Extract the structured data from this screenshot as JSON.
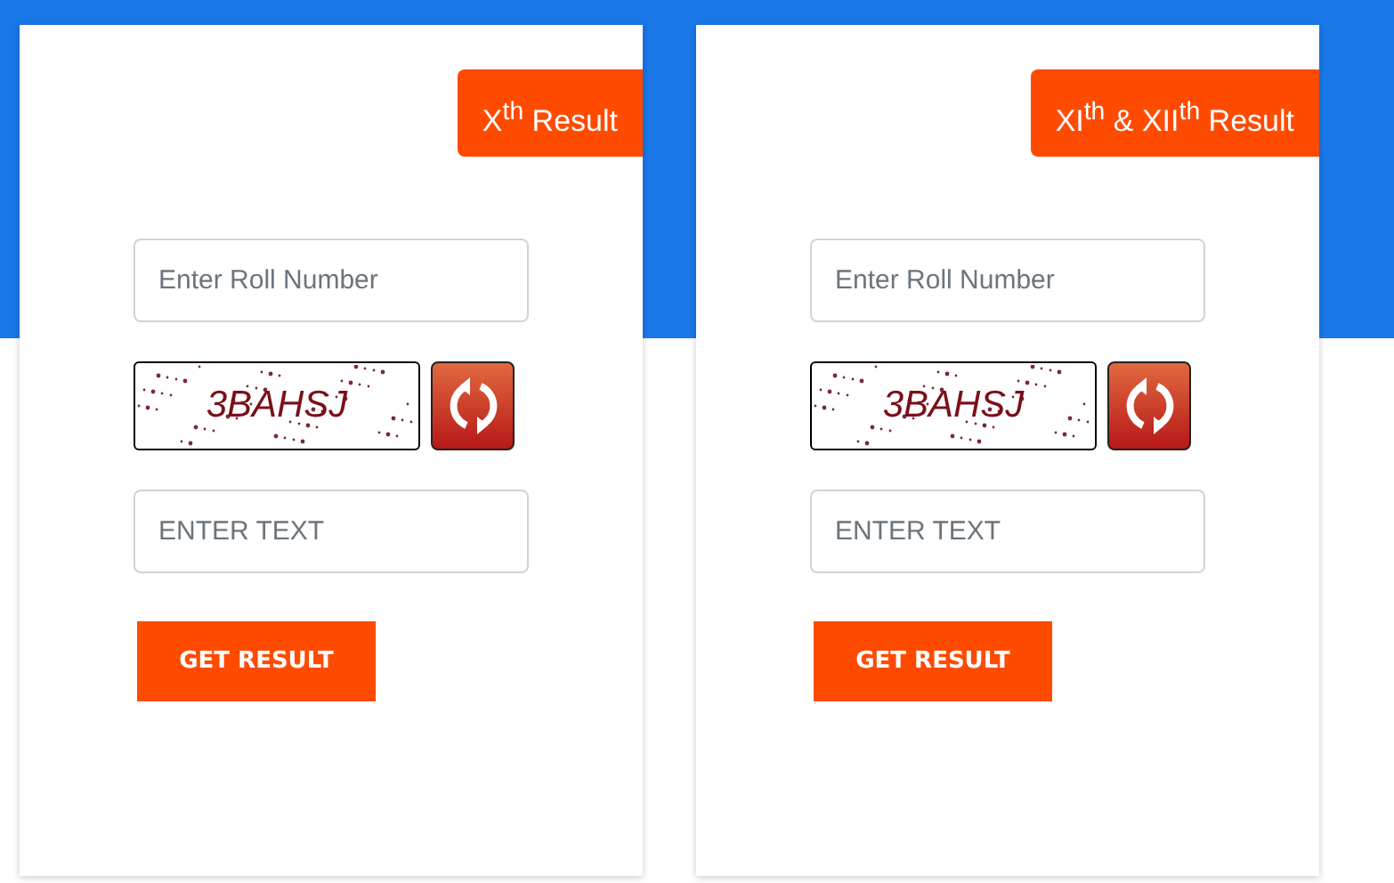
{
  "forms": [
    {
      "title": "X$^{th}$ Result",
      "roll_field": {
        "placeholder": "Enter Roll Number"
      },
      "captcha_text": "3BAHSJ",
      "text_field": {
        "placeholder": "ENTER TEXT"
      },
      "button": "GET RESULT"
    },
    {
      "title": "XI$^{th}$ & XII$^{th}$ Result",
      "roll_field": {
        "placeholder": "Enter Roll Number"
      },
      "captcha_text": "3BAHSJ",
      "text_field": {
        "placeholder": "ENTER TEXT"
      },
      "button": "GET RESULT"
    }
  ]
}
